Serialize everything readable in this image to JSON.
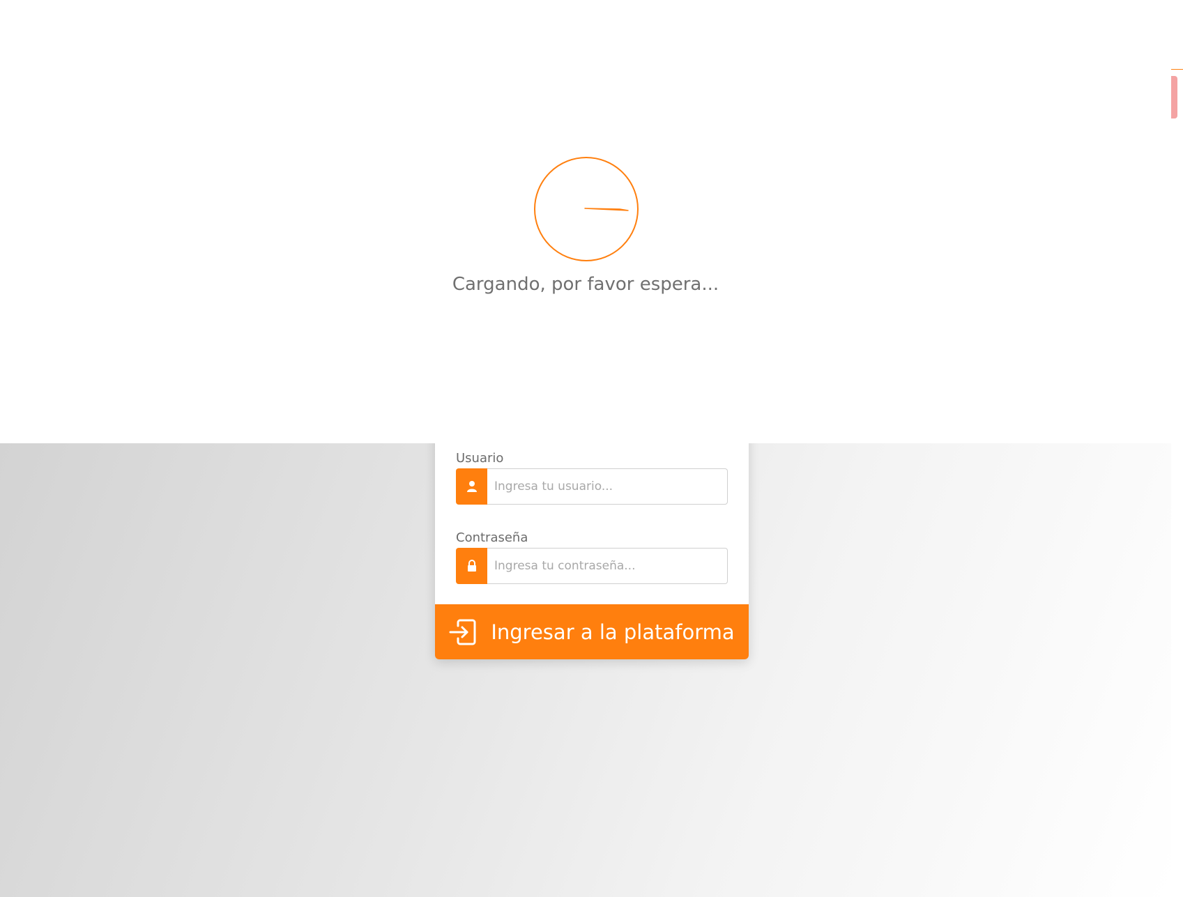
{
  "loading": {
    "text": "Cargando, por favor espera...",
    "spinner_icon": "spinner-icon"
  },
  "login": {
    "username_label": "Usuario",
    "username_placeholder": "Ingresa tu usuario...",
    "username_value": "",
    "username_icon": "user-icon",
    "password_label": "Contraseña",
    "password_placeholder": "Ingresa tu contraseña...",
    "password_value": "",
    "password_icon": "lock-icon",
    "submit_label": "Ingresar a la plataforma",
    "submit_icon": "sign-in-icon"
  },
  "colors": {
    "accent": "#ff7f0e",
    "text_muted": "#707070",
    "background_dark": "#d3d3d3",
    "background_light": "#ffffff"
  }
}
